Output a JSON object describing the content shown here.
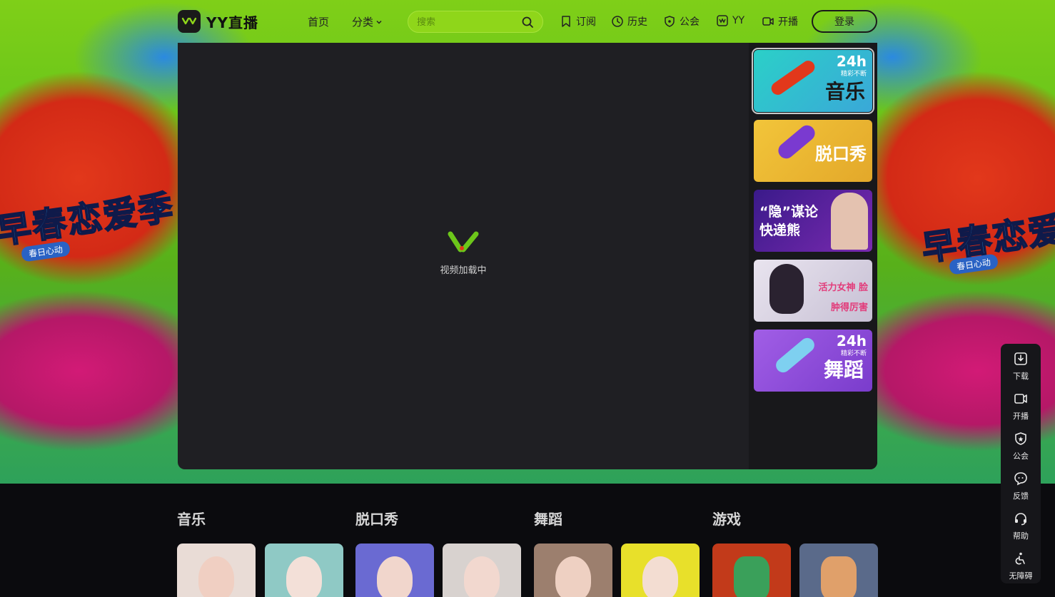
{
  "brand": {
    "logo_text": "YY直播"
  },
  "nav": {
    "home": "首页",
    "category": "分类",
    "search_placeholder": "搜索",
    "tools": [
      {
        "label": "订阅",
        "icon": "bookmark-icon"
      },
      {
        "label": "历史",
        "icon": "clock-icon"
      },
      {
        "label": "公会",
        "icon": "shield-icon"
      },
      {
        "label": "YY",
        "icon": "yy-icon"
      },
      {
        "label": "开播",
        "icon": "camera-icon"
      }
    ],
    "login": "登录"
  },
  "hero": {
    "slogan": "早春恋爱季",
    "subtitle": "春日心动",
    "colors": {
      "accent": "#7fcf18",
      "red": "#d32a16",
      "pink": "#b51867"
    }
  },
  "player": {
    "loading_text": "视频加载中"
  },
  "rail": [
    {
      "title": "音乐",
      "tag": "24h",
      "tag_sub": "精彩不断",
      "bg": "#29c6c0",
      "active": true
    },
    {
      "title": "脱口秀",
      "tag": "",
      "tag_sub": "",
      "bg": "#e9b530",
      "active": false
    },
    {
      "title": "“隐”谋论 快递熊",
      "tag": "",
      "tag_sub": "",
      "bg": "#5a2aa0",
      "active": false
    },
    {
      "title": "活力女神 脸肿得厉害",
      "tag": "",
      "tag_sub": "",
      "bg": "#cfc9d8",
      "active": false
    },
    {
      "title": "舞蹈",
      "tag": "24h",
      "tag_sub": "精彩不断",
      "bg": "#8a4fd6",
      "active": false
    }
  ],
  "float_tools": [
    {
      "label": "下载",
      "icon": "download-icon"
    },
    {
      "label": "开播",
      "icon": "camera-icon"
    },
    {
      "label": "公会",
      "icon": "shield-icon"
    },
    {
      "label": "反馈",
      "icon": "feedback-icon"
    },
    {
      "label": "帮助",
      "icon": "headset-icon"
    },
    {
      "label": "无障碍",
      "icon": "accessibility-icon"
    }
  ],
  "categories": [
    {
      "name": "音乐"
    },
    {
      "name": "脱口秀"
    },
    {
      "name": "舞蹈"
    },
    {
      "name": "游戏"
    }
  ]
}
